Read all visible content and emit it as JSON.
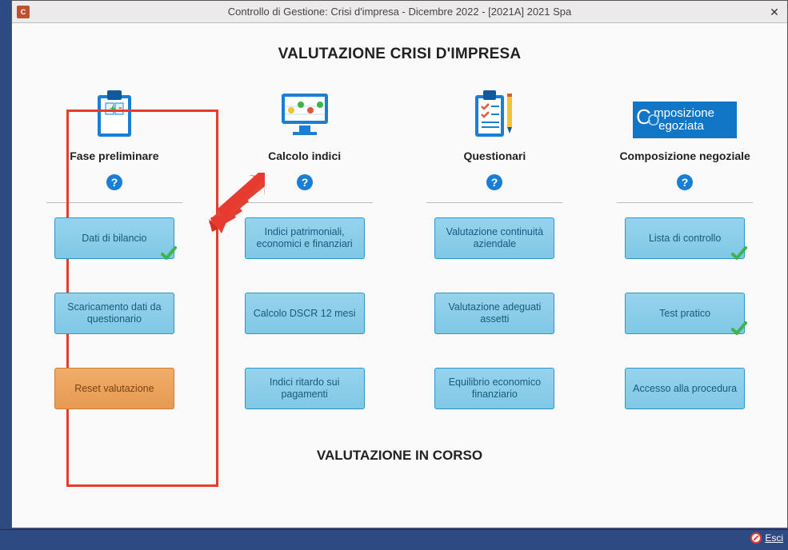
{
  "window": {
    "title": "Controllo di Gestione: Crisi d'impresa - Dicembre 2022 - [2021A] 2021 Spa"
  },
  "page": {
    "heading": "VALUTAZIONE CRISI D'IMPRESA",
    "section2": "VALUTAZIONE IN CORSO"
  },
  "columns": {
    "fase": {
      "title": "Fase preliminare",
      "b1": "Dati di bilancio",
      "b2": "Scaricamento dati da questionario",
      "b3": "Reset valutazione"
    },
    "calcolo": {
      "title": "Calcolo indici",
      "b1": "Indici patrimoniali, economici e finanziari",
      "b2": "Calcolo DSCR 12 mesi",
      "b3": "Indici ritardo sui pagamenti"
    },
    "questionari": {
      "title": "Questionari",
      "b1": "Valutazione continuità aziendale",
      "b2": "Valutazione adeguati assetti",
      "b3": "Equilibrio economico finanziario"
    },
    "composizione": {
      "title": "Composizione negoziale",
      "logo_l1": "mposizione",
      "logo_l2": "egoziata",
      "b1": "Lista di controllo",
      "b2": "Test pratico",
      "b3": "Accesso alla procedura"
    }
  },
  "footer": {
    "esci": "Esci"
  }
}
